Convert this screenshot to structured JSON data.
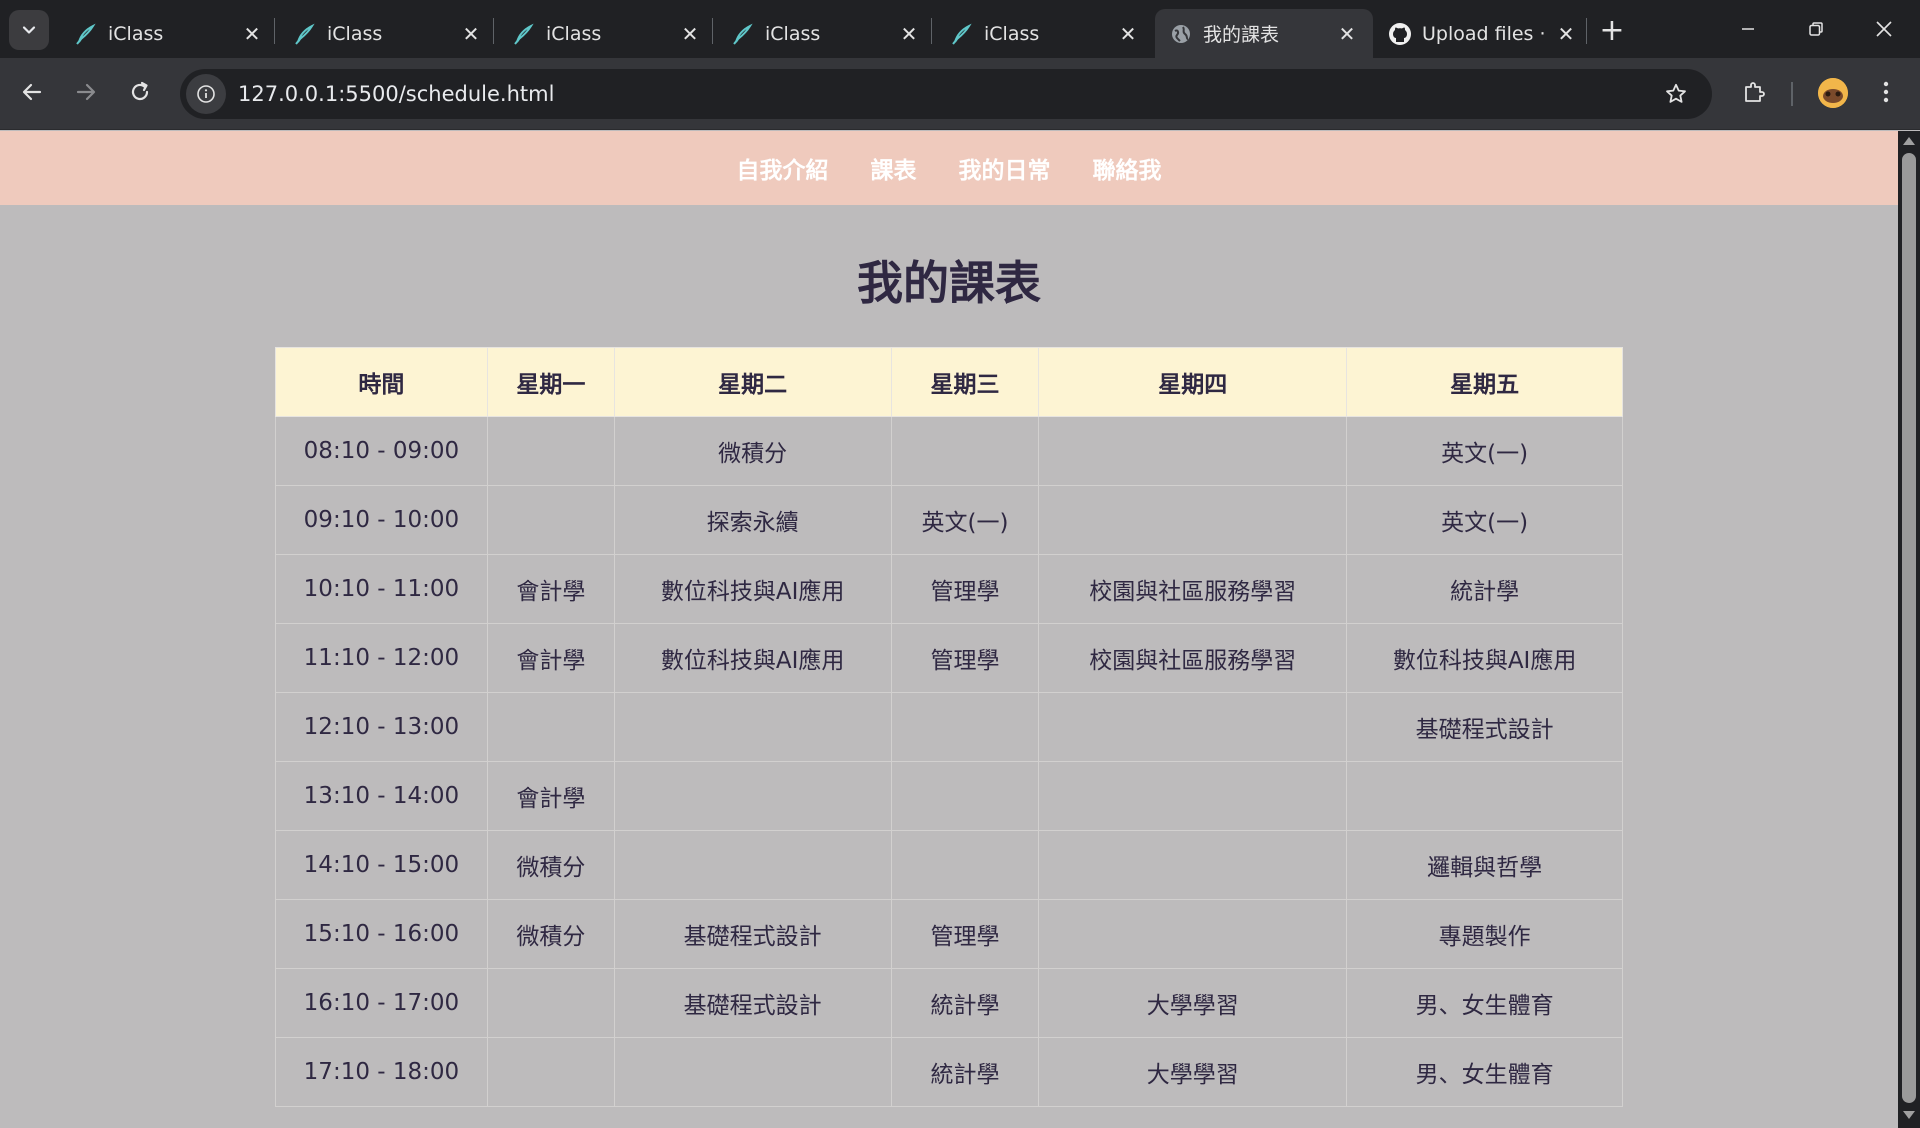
{
  "browser": {
    "tabs": [
      {
        "title": "iClass",
        "icon": "iclass-pen-icon",
        "active": false
      },
      {
        "title": "iClass",
        "icon": "iclass-pen-icon",
        "active": false
      },
      {
        "title": "iClass",
        "icon": "iclass-pen-icon",
        "active": false
      },
      {
        "title": "iClass",
        "icon": "iclass-pen-icon",
        "active": false
      },
      {
        "title": "iClass",
        "icon": "iclass-pen-icon",
        "active": false
      },
      {
        "title": "我的課表",
        "icon": "globe-icon",
        "active": true
      },
      {
        "title": "Upload files ·",
        "icon": "github-icon",
        "active": false
      }
    ],
    "url": "127.0.0.1:5500/schedule.html"
  },
  "nav": {
    "items": [
      "自我介紹",
      "課表",
      "我的日常",
      "聯絡我"
    ]
  },
  "page": {
    "title": "我的課表"
  },
  "schedule": {
    "headers": [
      "時間",
      "星期一",
      "星期二",
      "星期三",
      "星期四",
      "星期五"
    ],
    "rows": [
      [
        "08:10 - 09:00",
        "",
        "微積分",
        "",
        "",
        "英文(一)"
      ],
      [
        "09:10 - 10:00",
        "",
        "探索永續",
        "英文(一)",
        "",
        "英文(一)"
      ],
      [
        "10:10 - 11:00",
        "會計學",
        "數位科技與AI應用",
        "管理學",
        "校園與社區服務學習",
        "統計學"
      ],
      [
        "11:10 - 12:00",
        "會計學",
        "數位科技與AI應用",
        "管理學",
        "校園與社區服務學習",
        "數位科技與AI應用"
      ],
      [
        "12:10 - 13:00",
        "",
        "",
        "",
        "",
        "基礎程式設計"
      ],
      [
        "13:10 - 14:00",
        "會計學",
        "",
        "",
        "",
        ""
      ],
      [
        "14:10 - 15:00",
        "微積分",
        "",
        "",
        "",
        "邏輯與哲學"
      ],
      [
        "15:10 - 16:00",
        "微積分",
        "基礎程式設計",
        "管理學",
        "",
        "專題製作"
      ],
      [
        "16:10 - 17:00",
        "",
        "基礎程式設計",
        "統計學",
        "大學學習",
        "男、女生體育"
      ],
      [
        "17:10 - 18:00",
        "",
        "",
        "統計學",
        "大學學習",
        "男、女生體育"
      ]
    ]
  },
  "colors": {
    "navbar_bg": "#efcabd",
    "page_bg": "#bdbbbc",
    "table_header_bg": "#fdf4d3",
    "text": "#2f2842"
  }
}
